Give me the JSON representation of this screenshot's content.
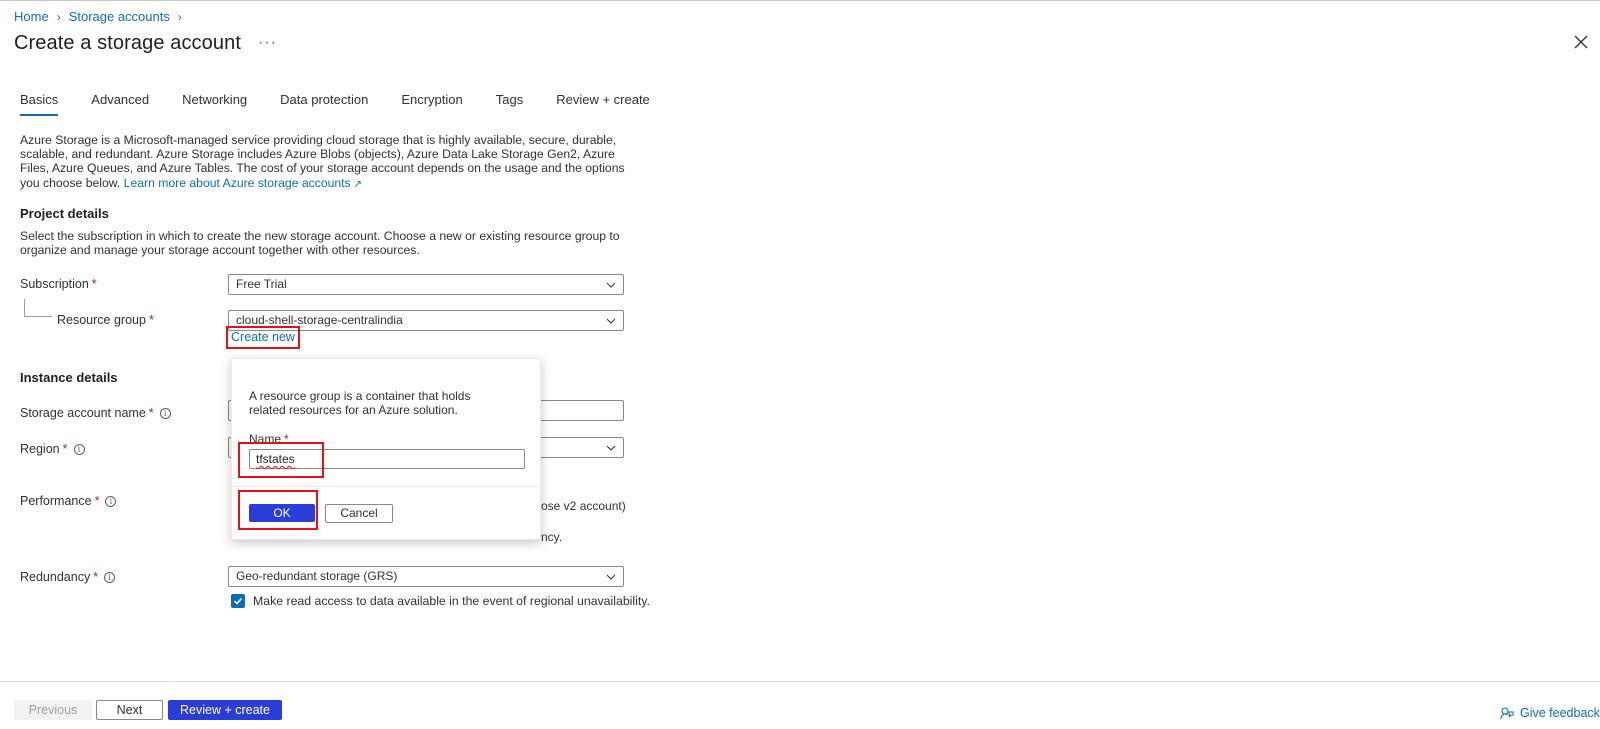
{
  "breadcrumb": {
    "home": "Home",
    "storage_accounts": "Storage accounts"
  },
  "title": "Create a storage account",
  "more": "···",
  "tabs": [
    "Basics",
    "Advanced",
    "Networking",
    "Data protection",
    "Encryption",
    "Tags",
    "Review + create"
  ],
  "intro": {
    "text": "Azure Storage is a Microsoft-managed service providing cloud storage that is highly available, secure, durable, scalable, and redundant. Azure Storage includes Azure Blobs (objects), Azure Data Lake Storage Gen2, Azure Files, Azure Queues, and Azure Tables. The cost of your storage account depends on the usage and the options you choose below. ",
    "link": "Learn more about Azure storage accounts"
  },
  "project": {
    "heading": "Project details",
    "description": "Select the subscription in which to create the new storage account. Choose a new or existing resource group to organize and manage your storage account together with other resources.",
    "subscription_label": "Subscription",
    "subscription_value": "Free Trial",
    "resource_group_label": "Resource group",
    "resource_group_value": "cloud-shell-storage-centralindia",
    "create_new": "Create new"
  },
  "instance": {
    "heading": "Instance details",
    "storage_name_label": "Storage account name",
    "region_label": "Region",
    "performance_label": "Performance",
    "performance_fragment_1": "ose v2 account)",
    "performance_fragment_2": "ncy.",
    "redundancy_label": "Redundancy",
    "redundancy_value": "Geo-redundant storage (GRS)",
    "read_access_label": "Make read access to data available in the event of regional unavailability.",
    "read_access_checked": true
  },
  "required_mark": "*",
  "popup": {
    "text": "A resource group is a container that holds related resources for an Azure solution.",
    "name_label": "Name",
    "name_value": "tfstates",
    "ok": "OK",
    "cancel": "Cancel"
  },
  "footer": {
    "previous": "Previous",
    "next": "Next",
    "review_create": "Review + create",
    "feedback": "Give feedback"
  },
  "colors": {
    "accent": "#0f6cbd",
    "primary_button": "#2b3dd9",
    "highlight": "#e3111b"
  }
}
